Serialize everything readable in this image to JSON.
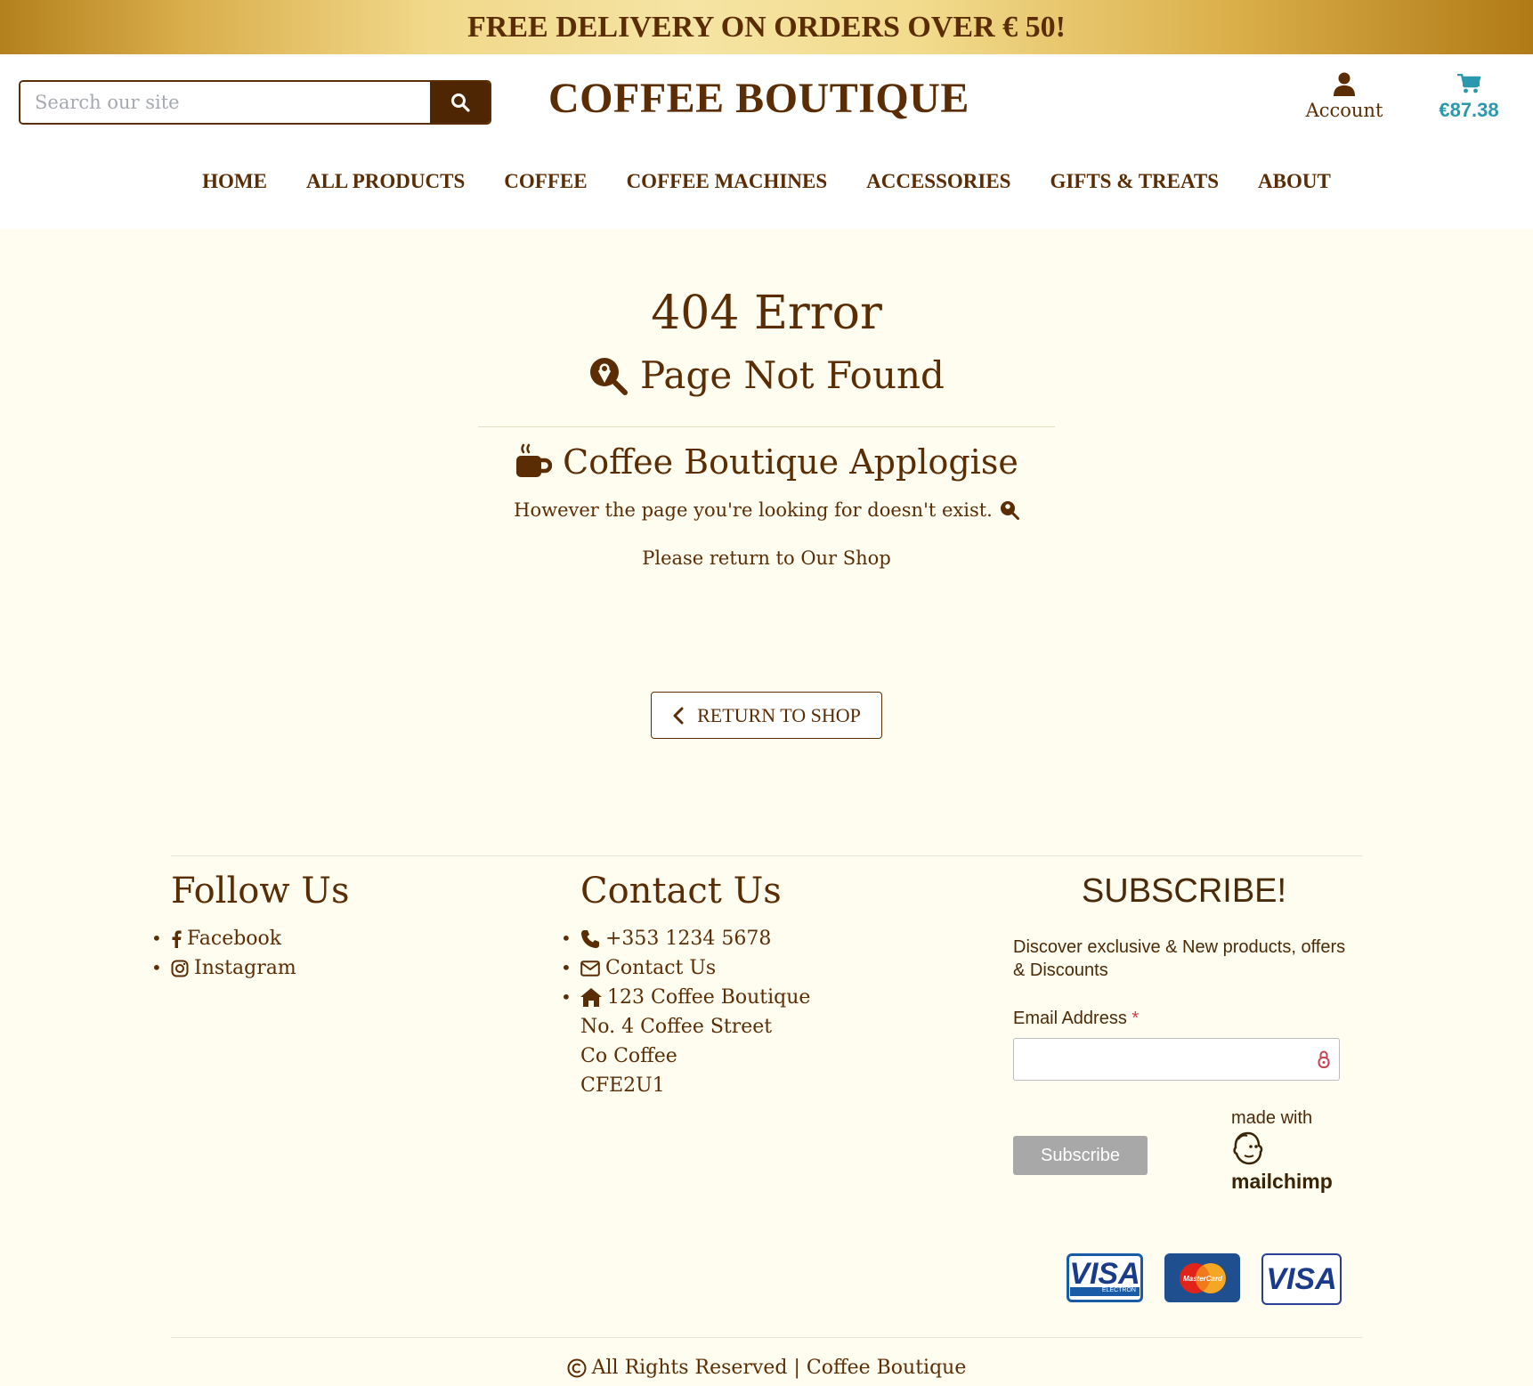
{
  "banner": {
    "text": "FREE DELIVERY ON ORDERS OVER € 50!"
  },
  "header": {
    "search_placeholder": "Search our site",
    "brand": "COFFEE BOUTIQUE",
    "account_label": "Account",
    "cart_total": "€87.38"
  },
  "nav": [
    "HOME",
    "ALL PRODUCTS",
    "COFFEE",
    "COFFEE MACHINES",
    "ACCESSORIES",
    "GIFTS & TREATS",
    "ABOUT"
  ],
  "error": {
    "code": "404 Error",
    "subtitle": "Page Not Found",
    "apologise": "Coffee Boutique Applogise",
    "message": "However the page you're looking for doesn't exist.",
    "return_text": "Please return to Our Shop",
    "return_button": "RETURN TO SHOP"
  },
  "footer": {
    "follow": {
      "title": "Follow Us",
      "facebook": "Facebook",
      "instagram": "Instagram"
    },
    "contact": {
      "title": "Contact Us",
      "phone": "+353 1234 5678",
      "email": "Contact Us",
      "address": [
        "123 Coffee Boutique",
        "No. 4 Coffee Street",
        "Co Coffee",
        "CFE2U1"
      ]
    },
    "subscribe": {
      "title": "SUBSCRIBE!",
      "description": "Discover exclusive & New products, offers & Discounts",
      "email_label": "Email Address",
      "required_mark": "*",
      "button": "Subscribe",
      "made_with": "made with",
      "mailchimp": "mailchimp"
    },
    "payment_cards": {
      "visa_electron": "VISA",
      "electron": "ELECTRON",
      "mastercard": "MasterCard",
      "visa": "VISA"
    },
    "copyright": "All Rights Reserved | Coffee Boutique"
  },
  "colors": {
    "brown": "#5a2d05",
    "cream": "#fffdef",
    "cart_teal": "#2b98ad",
    "gold": "#e9c86c"
  },
  "icons": [
    "search-icon",
    "user-icon",
    "cart-icon",
    "search-location-icon",
    "mug-hot-icon",
    "chevron-left-icon",
    "facebook-icon",
    "instagram-icon",
    "phone-icon",
    "envelope-icon",
    "home-icon",
    "lock-icon",
    "copyright-icon",
    "mailchimp-logo"
  ]
}
